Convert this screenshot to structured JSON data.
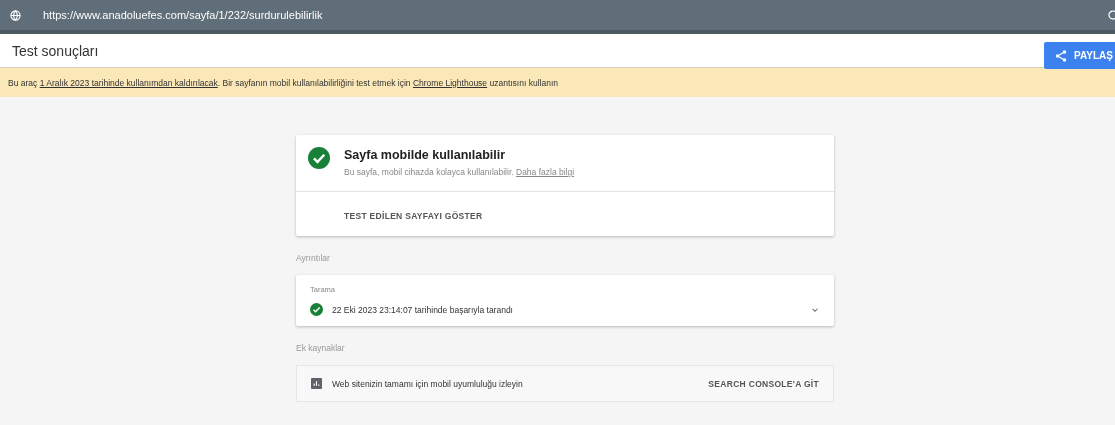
{
  "url_bar": {
    "url": "https://www.anadoluefes.com/sayfa/1/232/surdurulebilirlik"
  },
  "header": {
    "title": "Test sonuçları",
    "share_button": "PAYLAŞ"
  },
  "banner": [
    {
      "text": "Bu araç ",
      "kind": "text"
    },
    {
      "text": "1 Aralık 2023 tarihinde kullanımdan kaldırılacak",
      "kind": "link"
    },
    {
      "text": ". Bir sayfanın mobil kullanılabilirliğini test etmek için ",
      "kind": "text"
    },
    {
      "text": "Chrome Lighthouse",
      "kind": "link"
    },
    {
      "text": " uzantısını kullanın",
      "kind": "text"
    }
  ],
  "result": {
    "title": "Sayfa mobilde kullanılabilir",
    "description": "Bu sayfa, mobil cihazda kolayca kullanılabilir.",
    "link": "Daha fazla bilgi",
    "action": "TEST EDİLEN SAYFAYI GÖSTER"
  },
  "details": {
    "heading": "Ayrıntılar",
    "label": "Tarama",
    "status": "22 Eki 2023 23:14:07 tarihinde başarıyla tarandı",
    "expanded": false
  },
  "resources": {
    "heading": "Ek kaynaklar",
    "text": "Web sitenizin tamamı için mobil uyumluluğu izleyin",
    "action": "SEARCH CONSOLE'A GİT"
  }
}
